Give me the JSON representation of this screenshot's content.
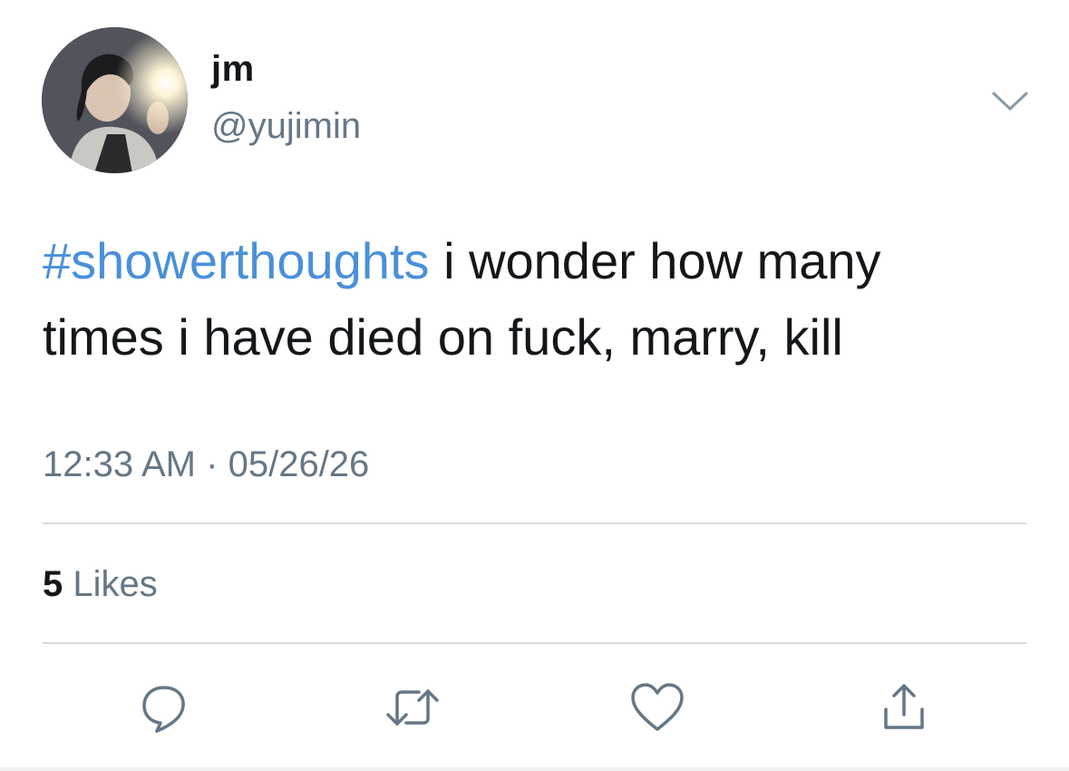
{
  "tweet": {
    "display_name": "jm",
    "handle": "@yujimin",
    "hashtag": "#showerthoughts",
    "text_line1": " i wonder how many",
    "text_line2": "times i have died on fuck, marry, kill",
    "time": "12:33 AM",
    "separator": "·",
    "date": "05/26/26",
    "likes_count": "5",
    "likes_label": "Likes"
  },
  "icons": {
    "menu": "chevron-down-icon",
    "reply": "reply-icon",
    "retweet": "retweet-icon",
    "like": "heart-icon",
    "share": "share-icon"
  },
  "colors": {
    "link": "#4a90d9",
    "text": "#14171a",
    "secondary": "#657786",
    "divider": "#d6dbe0"
  }
}
